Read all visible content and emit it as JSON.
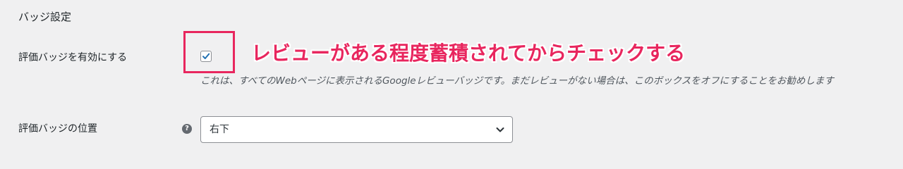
{
  "section": {
    "title": "バッジ設定"
  },
  "badge_enable": {
    "label": "評価バッジを有効にする",
    "checked": true,
    "description": "これは、すべてのWebページに表示されるGoogleレビューバッジです。まだレビューがない場合は、このボックスをオフにすることをお勧めします"
  },
  "annotation": {
    "text": "レビューがある程度蓄積されてからチェックする",
    "color": "#e8265e"
  },
  "badge_position": {
    "label": "評価バッジの位置",
    "help_icon": "question-circle-icon",
    "help_glyph": "?",
    "selected": "右下"
  },
  "colors": {
    "background": "#f0f0f1",
    "checkbox_check": "#2271b1",
    "highlight": "#e8265e"
  }
}
